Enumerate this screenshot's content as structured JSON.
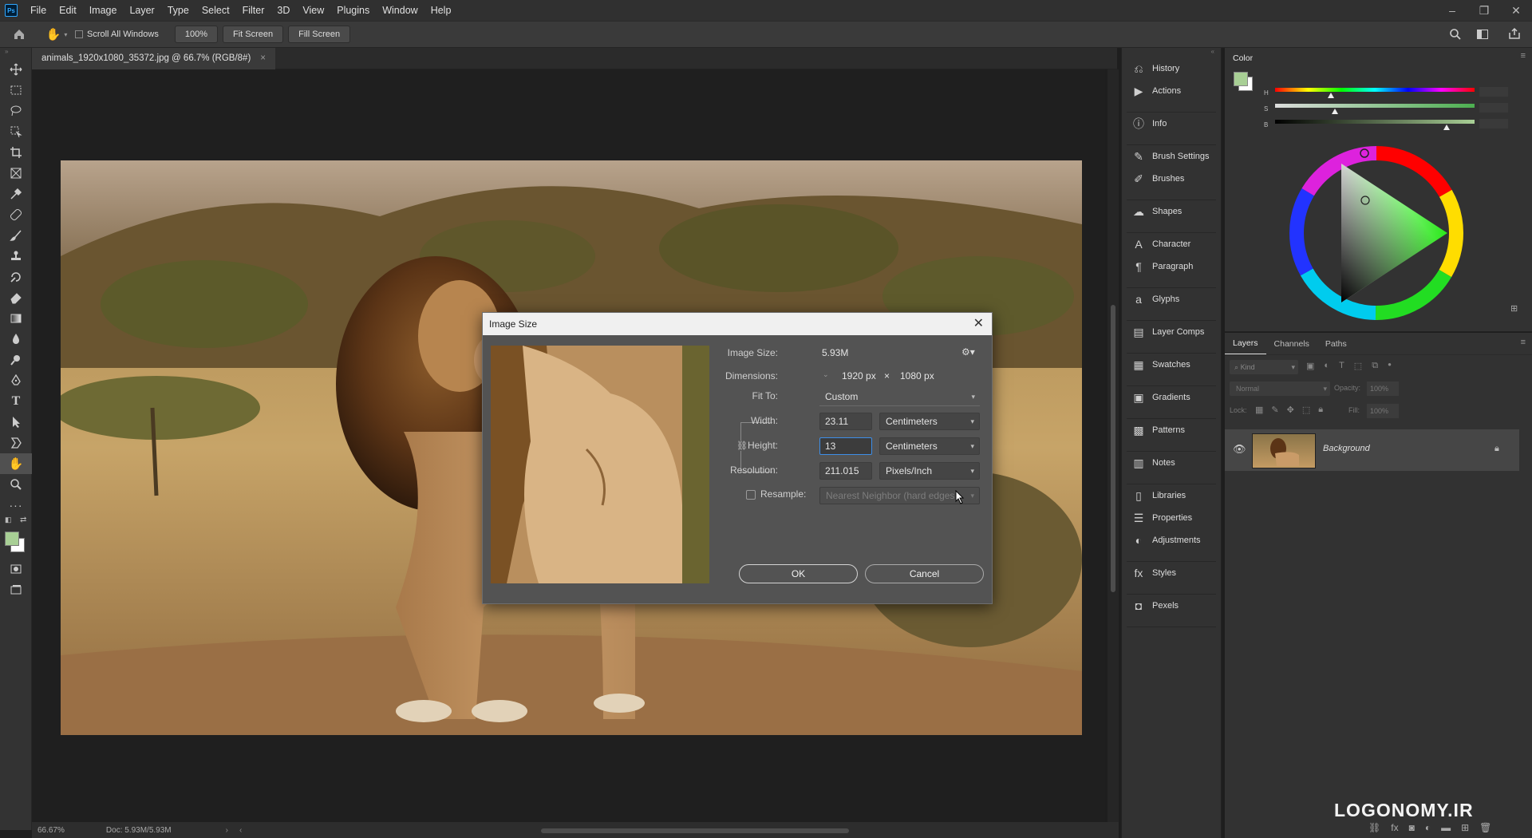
{
  "app": {
    "logo": "Ps"
  },
  "menu": [
    "File",
    "Edit",
    "Image",
    "Layer",
    "Type",
    "Select",
    "Filter",
    "3D",
    "View",
    "Plugins",
    "Window",
    "Help"
  ],
  "options_bar": {
    "scroll_all_windows": "Scroll All Windows",
    "zoom": "100%",
    "fit_screen": "Fit Screen",
    "fill_screen": "Fill Screen"
  },
  "document": {
    "tab_title": "animals_1920x1080_35372.jpg @ 66.7% (RGB/8#)",
    "tab_close": "×",
    "zoom_status": "66.67%",
    "doc_status": "Doc: 5.93M/5.93M"
  },
  "dialog": {
    "title": "Image Size",
    "close": "✕",
    "image_size_label": "Image Size:",
    "image_size_value": "5.93M",
    "dimensions_label": "Dimensions:",
    "dim_width": "1920 px",
    "dim_x": "×",
    "dim_height": "1080 px",
    "fit_to_label": "Fit To:",
    "fit_to_value": "Custom",
    "width_label": "Width:",
    "width_value": "23.11",
    "width_unit": "Centimeters",
    "height_label": "Height:",
    "height_value": "13",
    "height_unit": "Centimeters",
    "resolution_label": "Resolution:",
    "resolution_value": "211.015",
    "resolution_unit": "Pixels/Inch",
    "resample_label": "Resample:",
    "resample_value": "Nearest Neighbor (hard edges)",
    "ok": "OK",
    "cancel": "Cancel"
  },
  "panels": {
    "groups": [
      [
        {
          "icon": "history-icon",
          "label": "History"
        },
        {
          "icon": "actions-icon",
          "label": "Actions"
        }
      ],
      [
        {
          "icon": "info-icon",
          "label": "Info"
        }
      ],
      [
        {
          "icon": "brush-settings-icon",
          "label": "Brush Settings"
        },
        {
          "icon": "brushes-icon",
          "label": "Brushes"
        }
      ],
      [
        {
          "icon": "shapes-icon",
          "label": "Shapes"
        }
      ],
      [
        {
          "icon": "character-icon",
          "label": "Character"
        },
        {
          "icon": "paragraph-icon",
          "label": "Paragraph"
        }
      ],
      [
        {
          "icon": "glyphs-icon",
          "label": "Glyphs"
        }
      ],
      [
        {
          "icon": "layer-comps-icon",
          "label": "Layer Comps"
        }
      ],
      [
        {
          "icon": "swatches-icon",
          "label": "Swatches"
        }
      ],
      [
        {
          "icon": "gradients-icon",
          "label": "Gradients"
        }
      ],
      [
        {
          "icon": "patterns-icon",
          "label": "Patterns"
        }
      ],
      [
        {
          "icon": "notes-icon",
          "label": "Notes"
        }
      ],
      [
        {
          "icon": "libraries-icon",
          "label": "Libraries"
        },
        {
          "icon": "properties-icon",
          "label": "Properties"
        },
        {
          "icon": "adjustments-icon",
          "label": "Adjustments"
        }
      ],
      [
        {
          "icon": "styles-icon",
          "label": "Styles"
        }
      ],
      [
        {
          "icon": "pexels-icon",
          "label": "Pexels"
        }
      ]
    ]
  },
  "color_panel": {
    "title": "Color",
    "h_label": "H",
    "s_label": "S",
    "b_label": "B",
    "h_value": 0.28,
    "s_value": 0.3,
    "b_value": 0.86,
    "foreground": "#a8cf95",
    "background": "#ffffff"
  },
  "layers_panel": {
    "tabs": [
      "Layers",
      "Channels",
      "Paths"
    ],
    "kind_placeholder": "Kind",
    "blend_mode": "Normal",
    "opacity_label": "Opacity:",
    "opacity_value": "100%",
    "lock_label": "Lock:",
    "fill_label": "Fill:",
    "fill_value": "100%",
    "layer_name": "Background"
  },
  "watermark": "LOGONOMY.IR"
}
